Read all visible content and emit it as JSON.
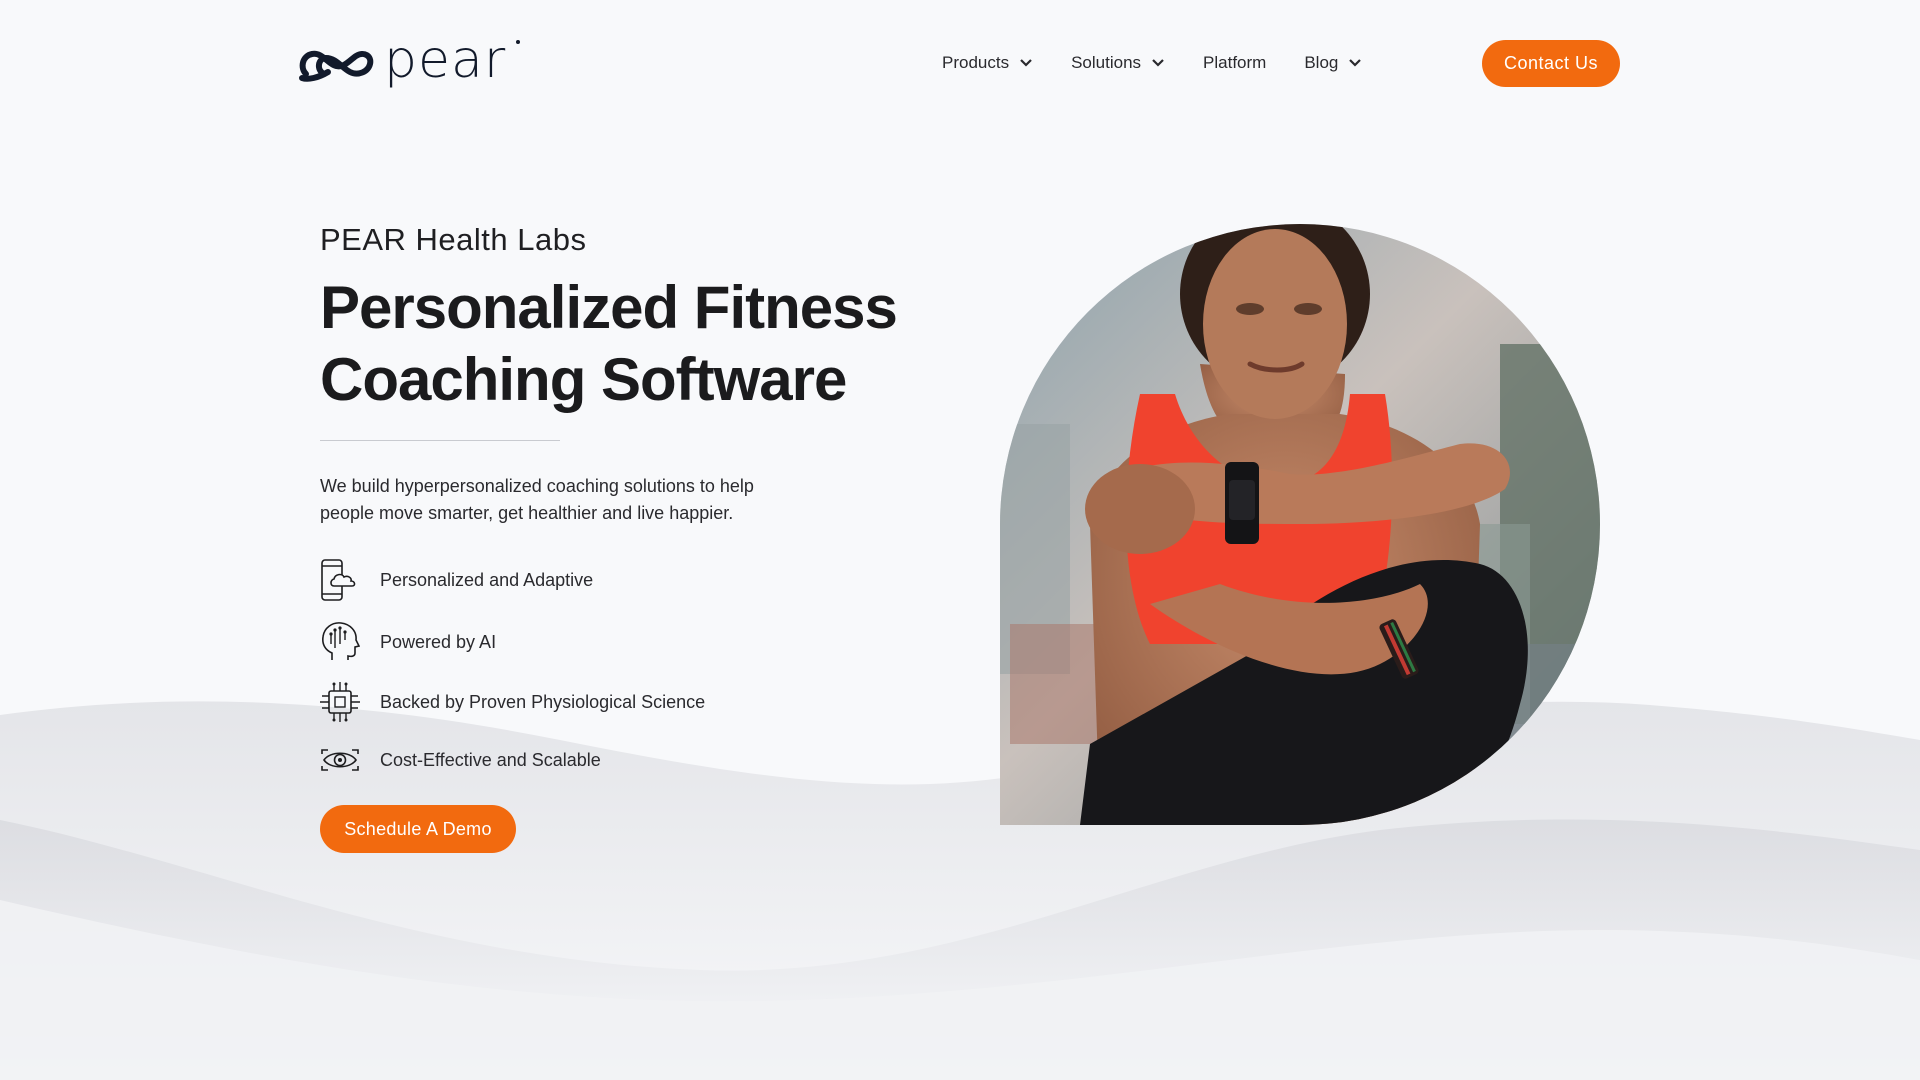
{
  "brand": {
    "name": "pear",
    "accent_color": "#f26a0f",
    "text_color": "#121a2b"
  },
  "nav": {
    "items": [
      {
        "label": "Products",
        "has_dropdown": true
      },
      {
        "label": "Solutions",
        "has_dropdown": true
      },
      {
        "label": "Platform",
        "has_dropdown": false
      },
      {
        "label": "Blog",
        "has_dropdown": true
      }
    ],
    "cta_label": "Contact Us"
  },
  "hero": {
    "eyebrow": "PEAR Health Labs",
    "headline_line1": "Personalized Fitness",
    "headline_line2": "Coaching Software",
    "lead": "We build hyperpersonalized coaching solutions to help people move smarter, get healthier and live happier.",
    "features": [
      {
        "icon": "phone-cloud-icon",
        "label": "Personalized and Adaptive"
      },
      {
        "icon": "ai-head-icon",
        "label": "Powered by AI"
      },
      {
        "icon": "chip-icon",
        "label": "Backed by Proven Physiological Science"
      },
      {
        "icon": "eye-scan-icon",
        "label": "Cost-Effective and Scalable"
      }
    ],
    "cta_label": "Schedule A Demo",
    "image": {
      "subject": "woman-checking-smartwatch",
      "shape": "rounded-leaf"
    }
  }
}
